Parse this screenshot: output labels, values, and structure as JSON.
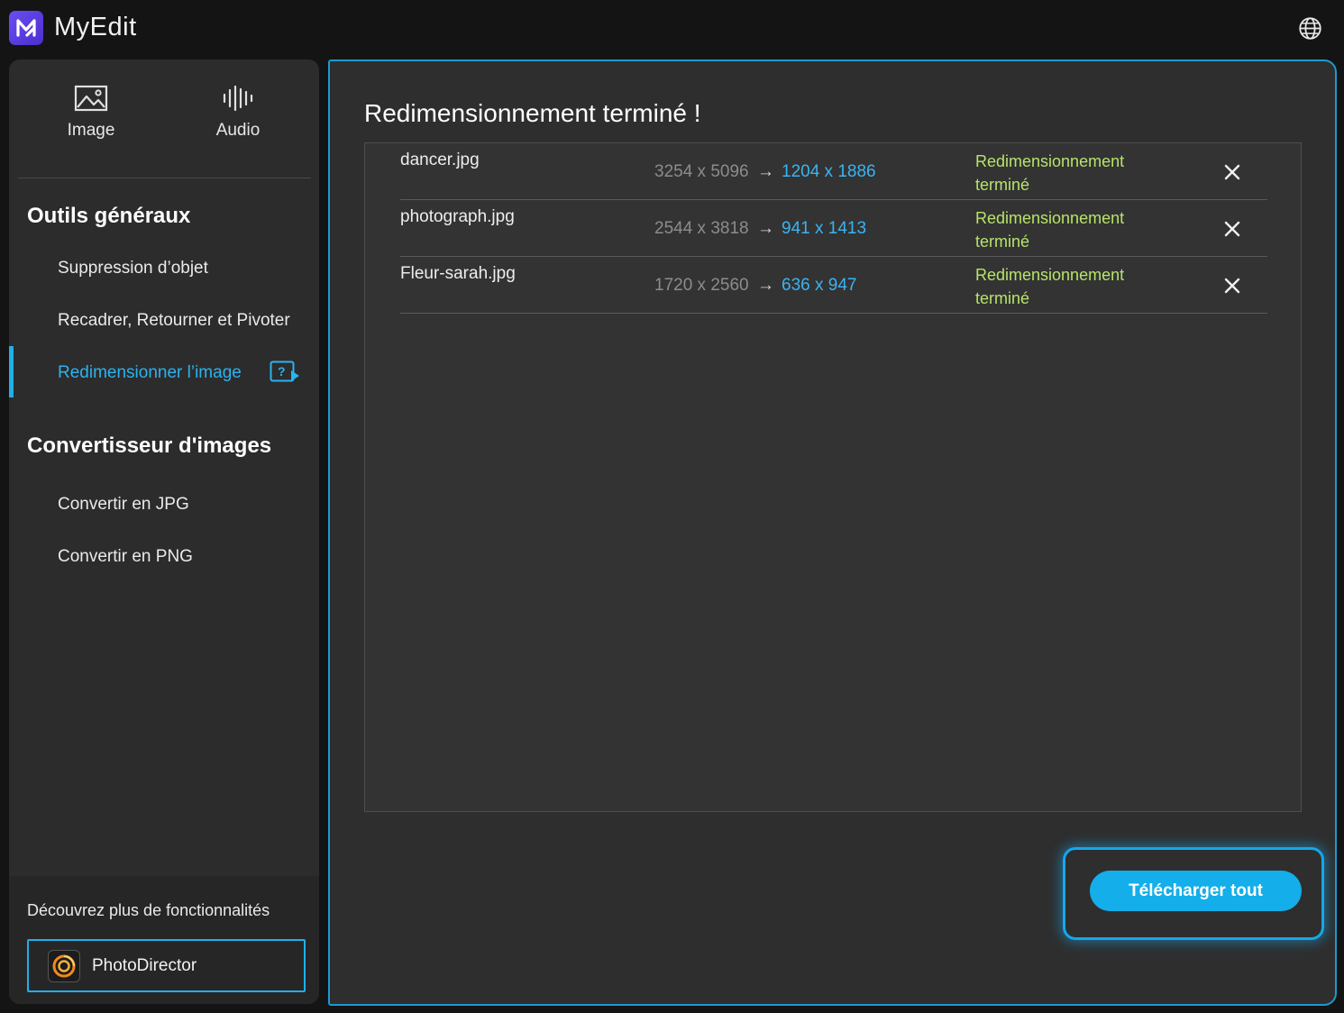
{
  "app": {
    "name": "MyEdit"
  },
  "header": {
    "language_icon": "globe-icon"
  },
  "sidebar": {
    "modes": [
      {
        "label": "Image",
        "icon": "image-icon"
      },
      {
        "label": "Audio",
        "icon": "audio-waveform-icon"
      }
    ],
    "sections": [
      {
        "title": "Outils généraux",
        "items": [
          {
            "label": "Suppression d’objet"
          },
          {
            "label": "Recadrer, Retourner et Pivoter"
          },
          {
            "label": "Redimensionner l’image",
            "active": true
          }
        ]
      },
      {
        "title": "Convertisseur d'images",
        "items": [
          {
            "label": "Convertir en JPG"
          },
          {
            "label": "Convertir en PNG"
          }
        ]
      }
    ],
    "footer": {
      "discover_text": "Découvrez plus de fonctionnalités",
      "promo_label": "PhotoDirector"
    }
  },
  "main": {
    "title": "Redimensionnement terminé !",
    "files": [
      {
        "name": "dancer.jpg",
        "original": "3254 x 5096",
        "arrow": "→",
        "resized": "1204 x 1886",
        "status": "Redimensionnement terminé"
      },
      {
        "name": "photograph.jpg",
        "original": "2544 x 3818",
        "arrow": "→",
        "resized": "941 x 1413",
        "status": "Redimensionnement terminé"
      },
      {
        "name": "Fleur-sarah.jpg",
        "original": "1720 x 2560",
        "arrow": "→",
        "resized": "636 x 947",
        "status": "Redimensionnement terminé"
      }
    ],
    "download_all_label": "Télécharger tout"
  },
  "colors": {
    "accent": "#1fb0ea",
    "status_green": "#b7e36b",
    "resized_blue": "#3ab4f2",
    "logo_purple": "#5b3ce0"
  }
}
